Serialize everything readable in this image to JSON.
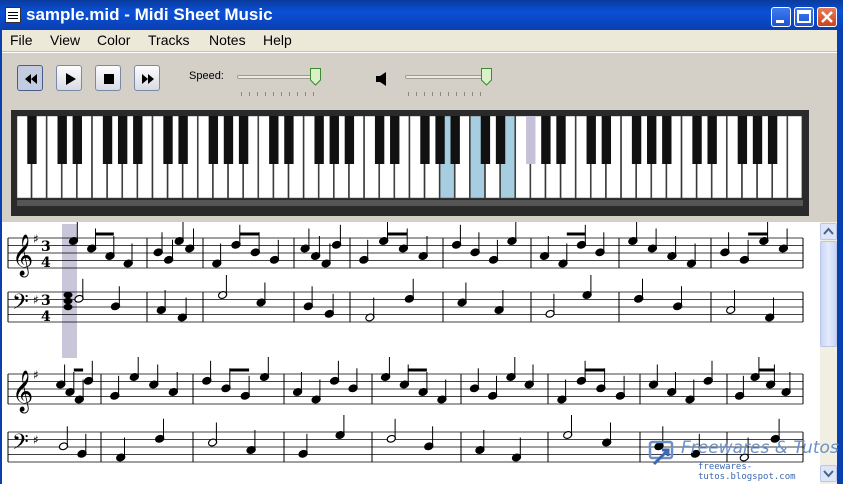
{
  "window": {
    "title": "sample.mid - Midi Sheet Music"
  },
  "menu": {
    "items": [
      "File",
      "View",
      "Color",
      "Tracks",
      "Notes",
      "Help"
    ]
  },
  "toolbar": {
    "speed_label": "Speed:",
    "speed_level": 1.0,
    "volume_level": 1.0,
    "buttons": [
      "rewind-icon",
      "play-icon",
      "stop-icon",
      "fast-forward-icon"
    ]
  },
  "piano": {
    "white_keys": 52,
    "highlighted_white_keys": [
      28,
      30,
      32
    ],
    "highlighted_black_keys": [
      33
    ],
    "highlight_color": "#a6cde0",
    "highlight_black_color": "#c7c0d9"
  },
  "sheet": {
    "time_signature": "3/4",
    "key_signature": "G major (one sharp)",
    "current_measure_highlight_color": "#c9c6d9"
  },
  "watermark": {
    "title": "Freewares & Tutos",
    "url": "freewares-tutos.blogspot.com"
  },
  "colors": {
    "titlebar": "#0b50d6",
    "menubar": "#ece9d8",
    "toolbar": "#d4d0c8"
  }
}
